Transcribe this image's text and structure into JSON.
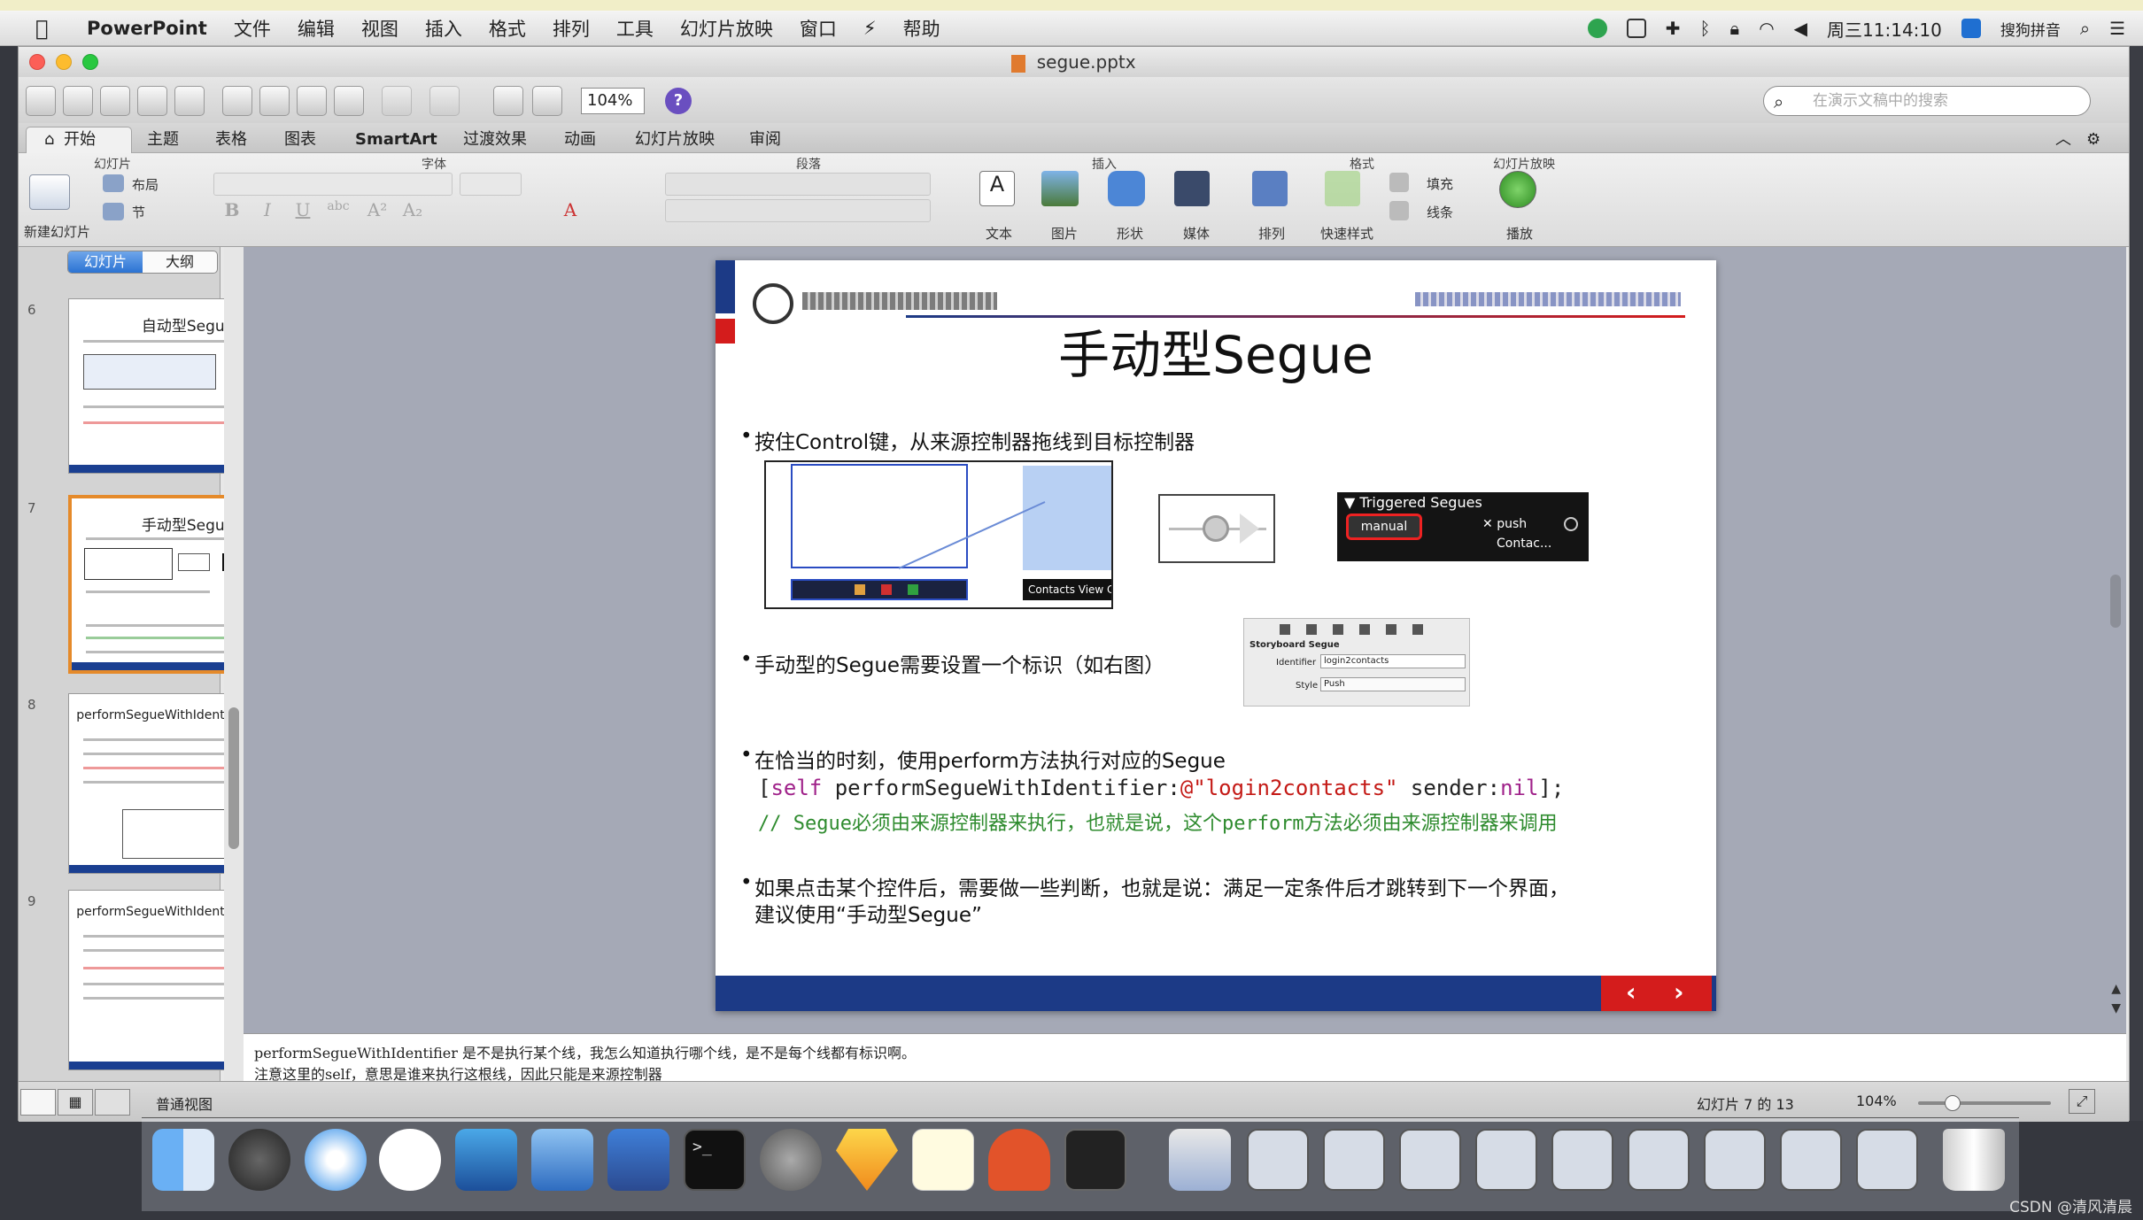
{
  "menubar": {
    "app": "PowerPoint",
    "items": [
      "文件",
      "编辑",
      "视图",
      "插入",
      "格式",
      "排列",
      "工具",
      "幻灯片放映",
      "窗口",
      "帮助"
    ],
    "clock": "周三11:14:10",
    "ime": "搜狗拼音"
  },
  "window": {
    "title": "segue.pptx",
    "zoom": "104%",
    "search_placeholder": "在演示文稿中的搜索"
  },
  "ribbon": {
    "tabs": [
      "开始",
      "主题",
      "表格",
      "图表",
      "SmartArt",
      "过渡效果",
      "动画",
      "幻灯片放映",
      "审阅"
    ],
    "groups": [
      "幻灯片",
      "字体",
      "段落",
      "插入",
      "格式",
      "幻灯片放映"
    ],
    "buttons": {
      "new_slide": "新建幻灯片",
      "layout": "布局",
      "section": "节",
      "text": "文本",
      "picture": "图片",
      "shape": "形状",
      "media": "媒体",
      "arrange": "排列",
      "quick_styles": "快速样式",
      "fill": "填充",
      "line": "线条",
      "play": "播放"
    }
  },
  "leftpane": {
    "seg_slides": "幻灯片",
    "seg_outline": "大纲",
    "thumbs": [
      {
        "num": "6",
        "title": "自动型Segue"
      },
      {
        "num": "7",
        "title": "手动型Segue"
      },
      {
        "num": "8",
        "title": "performSegueWithIdentifier:sender:"
      },
      {
        "num": "9",
        "title": "performSegueWithIdentifier:sender:"
      }
    ]
  },
  "slide": {
    "title": "手动型Segue",
    "bullet1": "按住Control键，从来源控制器拖线到目标控制器",
    "contacts_label": "Contacts View C",
    "triggered_title": "Triggered Segues",
    "manual": "manual",
    "push": "push",
    "contac": "Contac...",
    "bullet2": "手动型的Segue需要设置一个标识（如右图）",
    "sb_title": "Storyboard Segue",
    "sb_identifier_label": "Identifier",
    "sb_identifier_value": "login2contacts",
    "sb_style_label": "Style",
    "sb_style_value": "Push",
    "bullet3": "在恰当的时刻，使用perform方法执行对应的Segue",
    "code_open": "[",
    "code_self": "self",
    "code_method": " performSegueWithIdentifier:",
    "code_at": "@",
    "code_string": "\"login2contacts\"",
    "code_sender": " sender:",
    "code_nil": "nil",
    "code_close": "];",
    "code_comment": "// Segue必须由来源控制器来执行，也就是说，这个perform方法必须由来源控制器来调用",
    "bullet4_line1": "如果点击某个控件后，需要做一些判断，也就是说：满足一定条件后才跳转到下一个界面，",
    "bullet4_line2": "建议使用“手动型Segue”"
  },
  "notes": {
    "line1": "performSegueWithIdentifier 是不是执行某个线，我怎么知道执行哪个线，是不是每个线都有标识啊。",
    "line2": "注意这里的self，意思是谁来执行这根线，因此只能是来源控制器"
  },
  "status": {
    "view": "普通视图",
    "slide_pos": "幻灯片 7 的 13",
    "zoom": "104%"
  },
  "watermark": "CSDN @清风清晨",
  "colors": {
    "slide_blue": "#1c3a86",
    "slide_red": "#d41c1c",
    "code_keyword": "#a0228a",
    "code_string": "#c41a16",
    "code_comment": "#2e8b2e"
  }
}
